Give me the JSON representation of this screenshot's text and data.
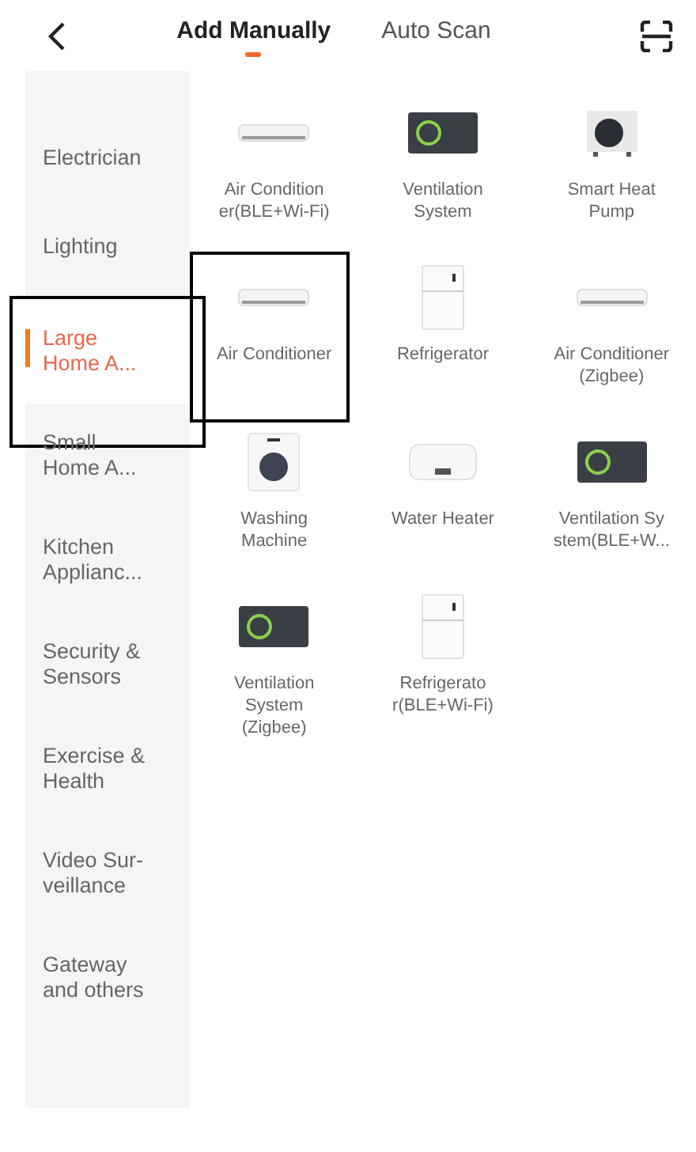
{
  "header": {
    "tabs": [
      {
        "label": "Add Manually",
        "selected": true
      },
      {
        "label": "Auto Scan",
        "selected": false
      }
    ]
  },
  "categories": [
    {
      "label": "Electrician",
      "selected": false,
      "outlined": false
    },
    {
      "label": "Lighting",
      "selected": false,
      "outlined": false
    },
    {
      "label": "Large Home A...",
      "selected": true,
      "outlined": true
    },
    {
      "label": "Small Home A...",
      "selected": false,
      "outlined": false
    },
    {
      "label": "Kitchen Applianc...",
      "selected": false,
      "outlined": false
    },
    {
      "label": "Security & Sensors",
      "selected": false,
      "outlined": false
    },
    {
      "label": "Exercise & Health",
      "selected": false,
      "outlined": false
    },
    {
      "label": "Video Sur-veillance",
      "selected": false,
      "outlined": false
    },
    {
      "label": "Gateway and others",
      "selected": false,
      "outlined": false
    }
  ],
  "devices": [
    {
      "kind": "ac",
      "label": "Air Condition er(BLE+Wi-Fi)",
      "outlined": false
    },
    {
      "kind": "vent",
      "label": "Ventilation System",
      "outlined": false
    },
    {
      "kind": "heatpump",
      "label": "Smart Heat Pump",
      "outlined": false
    },
    {
      "kind": "ac",
      "label": "Air Conditioner",
      "outlined": true
    },
    {
      "kind": "fridge",
      "label": "Refrigerator",
      "outlined": false
    },
    {
      "kind": "ac",
      "label": "Air Conditioner (Zigbee)",
      "outlined": false
    },
    {
      "kind": "washer",
      "label": "Washing Machine",
      "outlined": false
    },
    {
      "kind": "heater",
      "label": "Water Heater",
      "outlined": false
    },
    {
      "kind": "vent",
      "label": "Ventilation Sy stem(BLE+W...",
      "outlined": false
    },
    {
      "kind": "vent",
      "label": "Ventilation System (Zigbee)",
      "outlined": false
    },
    {
      "kind": "fridge",
      "label": "Refrigerato r(BLE+Wi-Fi)",
      "outlined": false
    }
  ]
}
